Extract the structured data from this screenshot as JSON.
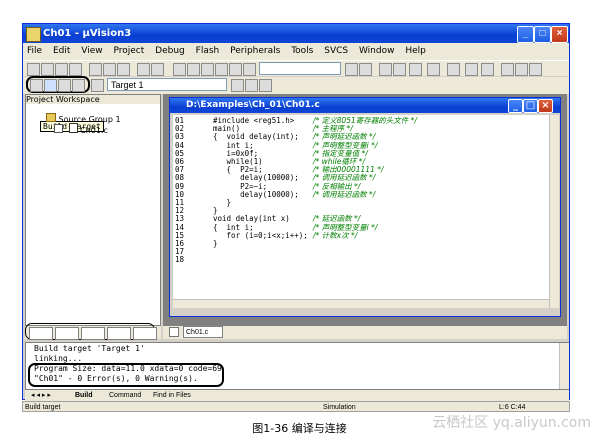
{
  "window": {
    "title": "Ch01 - μVision3"
  },
  "menu": [
    "File",
    "Edit",
    "View",
    "Project",
    "Debug",
    "Flash",
    "Peripherals",
    "Tools",
    "SVCS",
    "Window",
    "Help"
  ],
  "toolbar2": {
    "target_value": "Target 1"
  },
  "workspace": {
    "header": "Project Workspace",
    "tooltip": "Build target",
    "tree": {
      "group": "Source Group 1",
      "file": "Ch01.c"
    }
  },
  "editor": {
    "title": "D:\\Examples\\Ch_01\\Ch01.c",
    "tab": "Ch01.c",
    "lines": [
      {
        "n": "01",
        "code": "#include <reg51.h>",
        "comment": "/* 定义8051寄存器的头文件 */"
      },
      {
        "n": "02",
        "code": "main()",
        "comment": "/* 主程序 */"
      },
      {
        "n": "03",
        "code": "{  void delay(int);",
        "comment": "/* 声明延迟函数 */"
      },
      {
        "n": "04",
        "code": "   int i;",
        "comment": "/* 声明整型变量i */"
      },
      {
        "n": "05",
        "code": "   i=0x0f;",
        "comment": "/* 指定变量值 */"
      },
      {
        "n": "06",
        "code": "   while(1)",
        "comment": "/* while循环 */"
      },
      {
        "n": "07",
        "code": "   {  P2=i;",
        "comment": "/* 输出00001111 */"
      },
      {
        "n": "08",
        "code": "      delay(10000);",
        "comment": "/* 调用延迟函数 */"
      },
      {
        "n": "09",
        "code": "      P2=~i;",
        "comment": "/* 反相输出 */"
      },
      {
        "n": "10",
        "code": "      delay(10000);",
        "comment": "/* 调用延迟函数 */"
      },
      {
        "n": "11",
        "code": "   }",
        "comment": ""
      },
      {
        "n": "12",
        "code": "}",
        "comment": ""
      },
      {
        "n": "13",
        "code": "void delay(int x)",
        "comment": "/* 延迟函数 */"
      },
      {
        "n": "14",
        "code": "{  int i;",
        "comment": "/* 声明整型变量i */"
      },
      {
        "n": "15",
        "code": "   for (i=0;i<x;i++);",
        "comment": "/* 计数x次 */"
      },
      {
        "n": "16",
        "code": "}",
        "comment": ""
      },
      {
        "n": "17",
        "code": "",
        "comment": ""
      },
      {
        "n": "18",
        "code": "",
        "comment": ""
      }
    ]
  },
  "output": {
    "lines": [
      "Build target 'Target 1'",
      "linking...",
      "Program Size: data=11.0 xdata=0 code=69",
      "\"Ch01\" - 0 Error(s), 0 Warning(s)."
    ],
    "tabs": [
      "Build",
      "Command",
      "Find in Files"
    ]
  },
  "statusbar": {
    "left": "Build target",
    "mode": "Simulation",
    "pos": "L:6 C:44"
  },
  "caption": "图1-36 编译与连接",
  "watermark": "云栖社区 yq.aliyun.com"
}
